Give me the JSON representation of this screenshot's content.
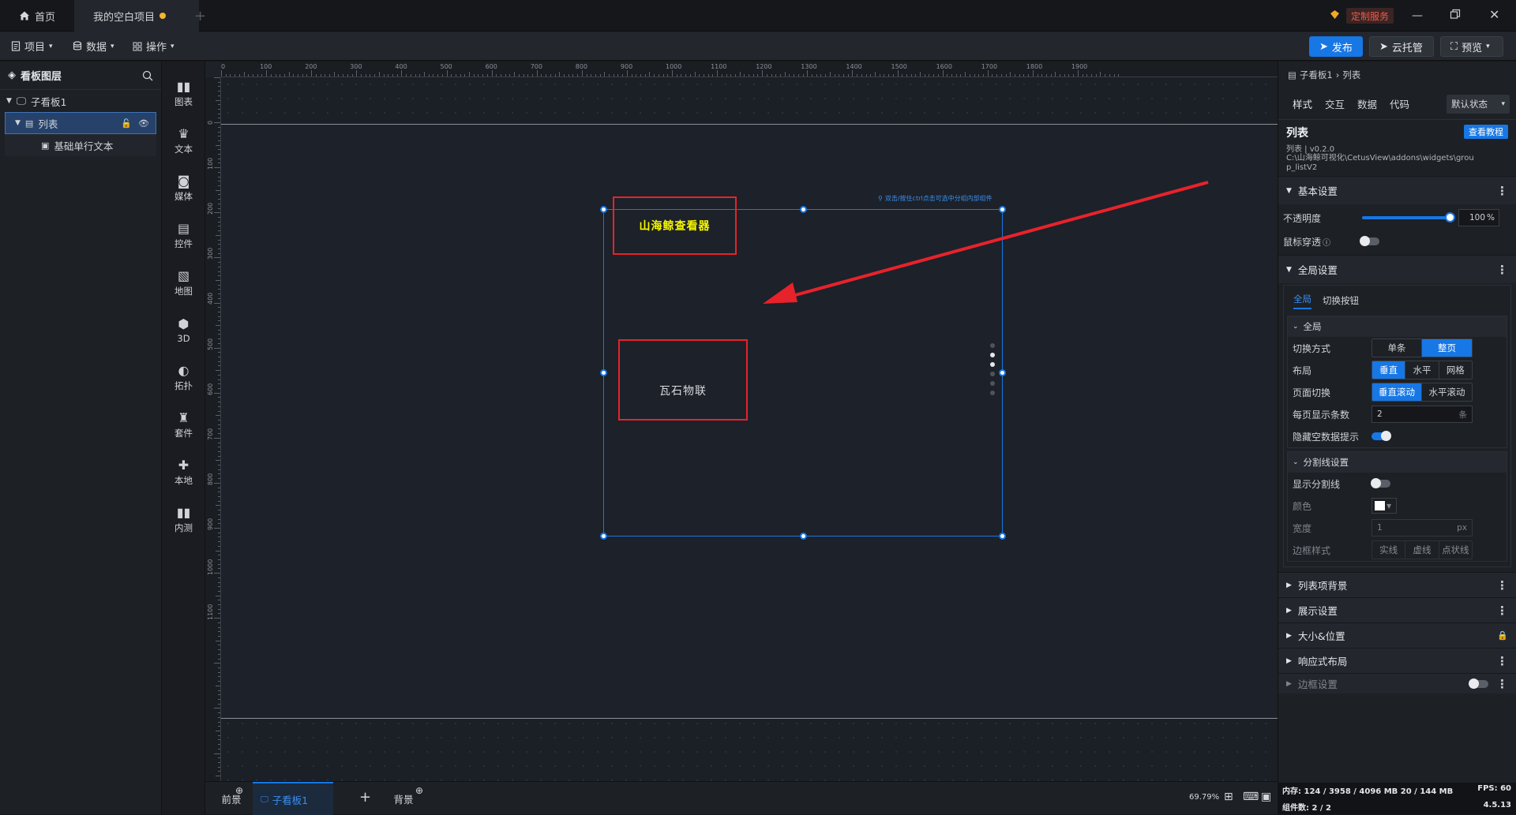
{
  "tabs": {
    "home": "首页",
    "project": "我的空白项目"
  },
  "window": {
    "custom_service": "定制服务"
  },
  "toolbar": {
    "project": "项目",
    "data": "数据",
    "operate": "操作",
    "publish": "发布",
    "cloud": "云托管",
    "preview": "预览"
  },
  "layers": {
    "title": "看板图层",
    "items": [
      {
        "label": "子看板1"
      },
      {
        "label": "列表"
      },
      {
        "label": "基础单行文本"
      }
    ]
  },
  "widget_bar": [
    "图表",
    "文本",
    "媒体",
    "控件",
    "地图",
    "3D",
    "拓扑",
    "套件",
    "本地",
    "内测"
  ],
  "ruler": {
    "top": [
      "0",
      "100",
      "200",
      "300",
      "400",
      "500",
      "600",
      "700",
      "800",
      "900",
      "1000",
      "1100",
      "1200",
      "1300",
      "1400",
      "1500",
      "1600",
      "1700",
      "1800",
      "1900"
    ],
    "left": [
      "0",
      "100",
      "200",
      "300",
      "400",
      "500",
      "600",
      "700",
      "800",
      "900",
      "1000",
      "1100"
    ]
  },
  "canvas": {
    "hint": "双击/按住ctrl点击可选中分组内部组件",
    "item1_text": "山海鲸查看器",
    "item2_text": "瓦石物联",
    "colors": {
      "item1_text": "#f7f700",
      "highlight_box": "#e8222a",
      "selection": "#1677e5",
      "arrow": "#e8222a"
    }
  },
  "bottom": {
    "foreground": "前景",
    "board_tab": "子看板1",
    "add": "+",
    "background": "背景",
    "zoom": "69.79%"
  },
  "panel": {
    "breadcrumb": [
      "子看板1",
      "列表"
    ],
    "tabs": [
      "样式",
      "交互",
      "数据",
      "代码"
    ],
    "state_select": "默认状态",
    "widget_name": "列表",
    "widget_version": "列表 | v0.2.0",
    "widget_path": "C:\\山海鲸可视化\\CetusView\\addons\\widgets\\group_listV2",
    "tutorial_button": "查看教程",
    "basic": {
      "title": "基本设置",
      "opacity_label": "不透明度",
      "opacity_value": "100",
      "opacity_unit": "%",
      "mouse_through": "鼠标穿透"
    },
    "global": {
      "title": "全局设置",
      "subtabs": [
        "全局",
        "切换按钮"
      ],
      "group_title": "全局",
      "switch_mode": {
        "label": "切换方式",
        "options": [
          "单条",
          "整页"
        ],
        "selected": "整页"
      },
      "layout": {
        "label": "布局",
        "options": [
          "垂直",
          "水平",
          "网格"
        ],
        "selected": "垂直"
      },
      "page_switch": {
        "label": "页面切换",
        "options": [
          "垂直滚动",
          "水平滚动"
        ],
        "selected": "垂直滚动"
      },
      "per_page": {
        "label": "每页显示条数",
        "value": "2",
        "unit": "条"
      },
      "hide_empty": {
        "label": "隐藏空数据提示",
        "on": true
      }
    },
    "divider": {
      "title": "分割线设置",
      "show": {
        "label": "显示分割线",
        "on": false
      },
      "color_label": "颜色",
      "width": {
        "label": "宽度",
        "value": "1",
        "unit": "px"
      },
      "border_style": {
        "label": "边框样式",
        "options": [
          "实线",
          "虚线",
          "点状线"
        ]
      }
    },
    "collapsed": [
      "列表项背景",
      "展示设置",
      "大小&位置",
      "响应式布局",
      "边框设置"
    ]
  },
  "status": {
    "memory": "内存: 124 / 3958 / 4096 MB  20 / 144 MB",
    "fps": "FPS: 60",
    "count": "组件数: 2 / 2",
    "version": "4.5.13"
  },
  "page_dots": {
    "count": 6,
    "active_index": 1
  }
}
